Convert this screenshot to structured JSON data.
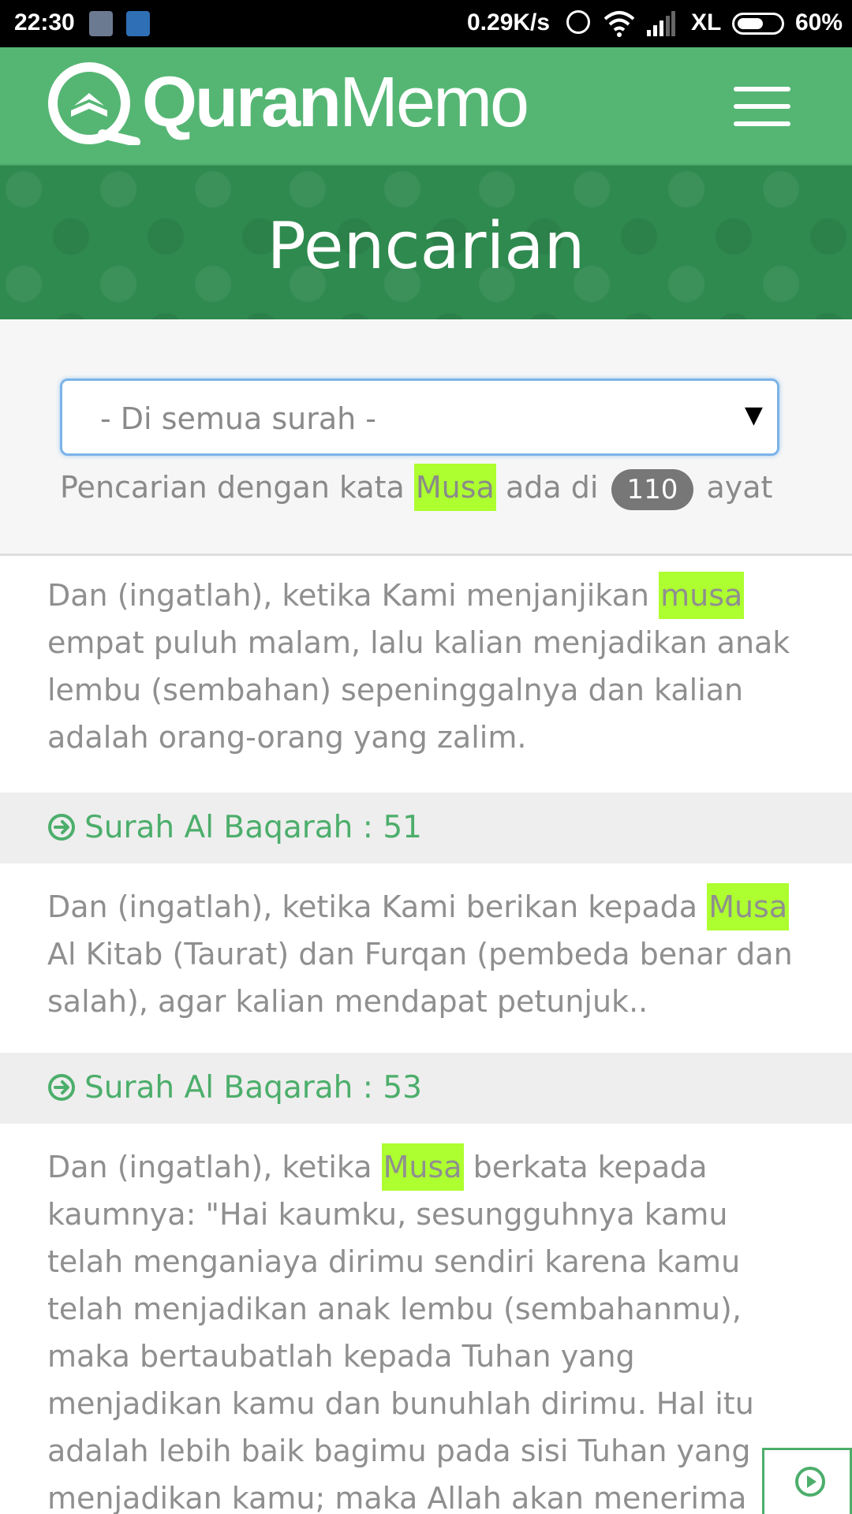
{
  "status_bar": {
    "time": "22:30",
    "speed": "0.29K/s",
    "carrier": "XL",
    "battery_text": "60%",
    "battery_level": 0.6
  },
  "header": {
    "logo_text_bold": "Quran",
    "logo_text_light": "Memo",
    "brand_color": "#55b674"
  },
  "banner": {
    "title": "Pencarian"
  },
  "filter": {
    "selected_surah": "- Di semua surah -",
    "summary_prefix": "Pencarian dengan kata",
    "keyword": "Musa",
    "summary_middle": "ada di",
    "count": "110",
    "summary_suffix": "ayat"
  },
  "results": [
    {
      "before": "Dan (ingatlah), ketika Kami menjanjikan",
      "match": "musa",
      "after": "empat puluh malam, lalu kalian menjadikan anak lembu (sembahan) sepeninggalnya dan kalian adalah orang-orang yang zalim.",
      "ref": "Surah Al Baqarah : 51"
    },
    {
      "before": "Dan (ingatlah), ketika Kami berikan kepada",
      "match": "Musa",
      "after": "Al Kitab (Taurat) dan Furqan (pembeda benar dan salah), agar kalian mendapat petunjuk..",
      "ref": "Surah Al Baqarah : 53"
    },
    {
      "before": "Dan (ingatlah), ketika",
      "match": "Musa",
      "after": "berkata kepada kaumnya: \"Hai kaumku, sesungguhnya kamu telah menganiaya dirimu sendiri karena kamu telah menjadikan anak lembu (sembahanmu), maka bertaubatlah kepada Tuhan yang menjadikan kamu dan bunuhlah dirimu. Hal itu adalah lebih baik bagimu pada sisi Tuhan yang menjadikan kamu; maka Allah akan menerima taubatmu."
    }
  ],
  "icons": {
    "menu": "hamburger-icon",
    "ref_arrow": "circle-arrow-right-icon",
    "play": "play-circle-icon"
  },
  "colors": {
    "highlight": "#adff2f",
    "ref_text": "#4cae6b",
    "banner": "#2f8a4f"
  }
}
